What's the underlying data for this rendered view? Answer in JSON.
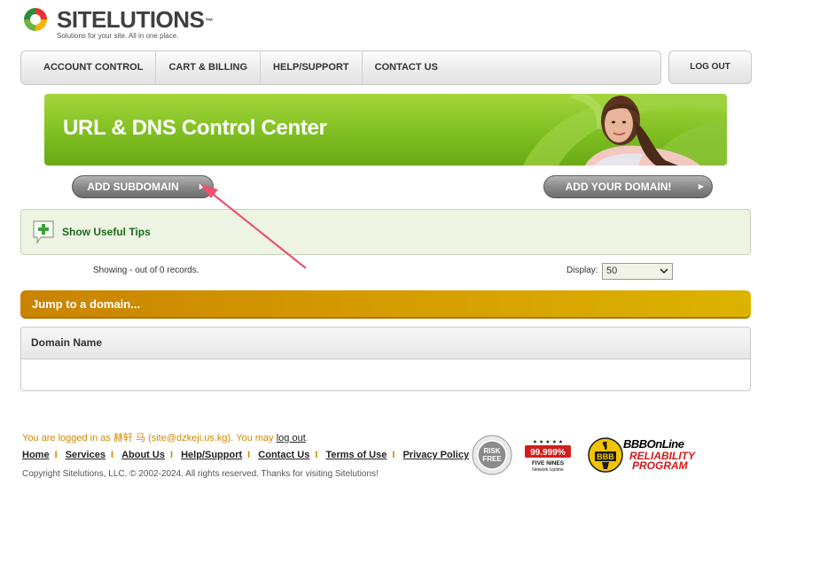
{
  "brand": {
    "name": "SITELUTIONS",
    "trademark": "™",
    "tagline": "Solutions for your site. All in one place."
  },
  "nav": {
    "items": [
      {
        "label": "ACCOUNT CONTROL"
      },
      {
        "label": "CART & BILLING"
      },
      {
        "label": "HELP/SUPPORT"
      },
      {
        "label": "CONTACT US"
      }
    ],
    "logout_label": "LOG OUT"
  },
  "banner": {
    "title": "URL & DNS Control Center"
  },
  "actions": {
    "add_subdomain": "ADD SUBDOMAIN",
    "add_domain": "ADD YOUR DOMAIN!"
  },
  "tips": {
    "label": "Show Useful Tips"
  },
  "records": {
    "showing_text": "Showing - out of 0 records.",
    "display_label": "Display:",
    "display_value": "50"
  },
  "jump": {
    "label": "Jump to a domain..."
  },
  "table": {
    "columns": [
      "Domain Name"
    ],
    "rows": []
  },
  "footer": {
    "logged_prefix": "You are logged in as 赫轩 马 (site@dzkeji.us.kg). You may ",
    "logout_link": "log out",
    "logged_suffix": ".",
    "links": [
      "Home",
      "Services",
      "About Us",
      "Help/Support",
      "Contact Us",
      "Terms of Use",
      "Privacy Policy"
    ],
    "copyright": "Copyright Sitelutions, LLC. © 2002-2024. All rights reserved.  Thanks for visiting Sitelutions!"
  },
  "badges": {
    "risk_free": "RISK FREE",
    "uptime_percent": "99.999%",
    "uptime_label1": "FIVE NINES",
    "uptime_label2": "Network Uptime",
    "bbb_online": "BBBOnLine",
    "bbb_logo": "BBB",
    "bbb_reliability": "RELIABILITY",
    "bbb_program": "PROGRAM"
  },
  "colors": {
    "banner_green": "#7fbf22",
    "jump_orange": "#d49a00",
    "annotation_arrow": "#f0506e"
  }
}
